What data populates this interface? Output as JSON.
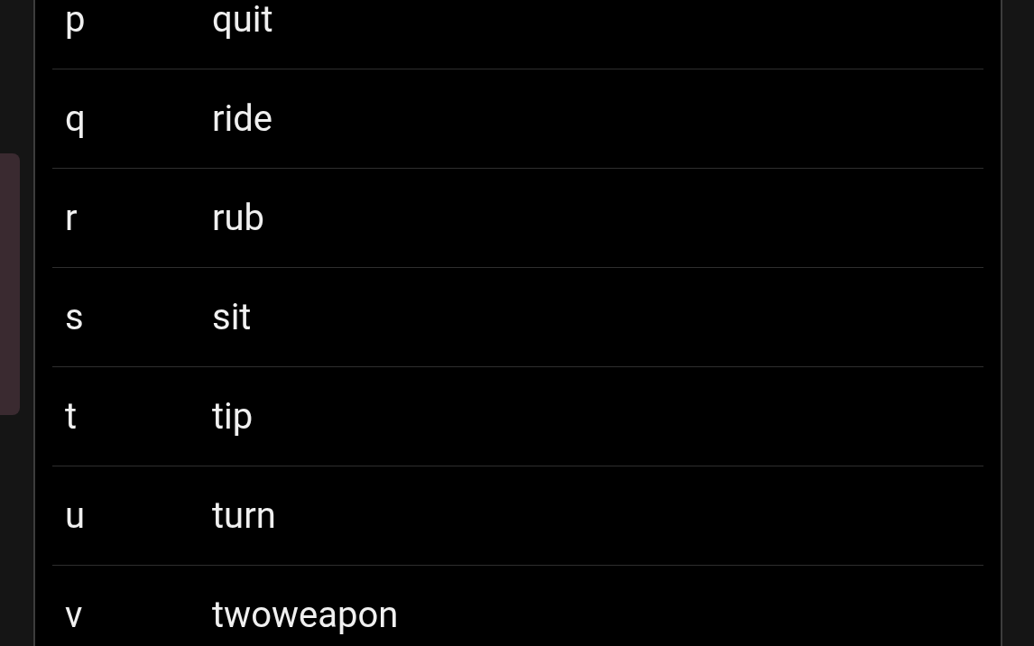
{
  "menu": {
    "items": [
      {
        "key": "p",
        "command": "quit"
      },
      {
        "key": "q",
        "command": "ride"
      },
      {
        "key": "r",
        "command": "rub"
      },
      {
        "key": "s",
        "command": "sit"
      },
      {
        "key": "t",
        "command": "tip"
      },
      {
        "key": "u",
        "command": "turn"
      },
      {
        "key": "v",
        "command": "twoweapon"
      }
    ]
  }
}
